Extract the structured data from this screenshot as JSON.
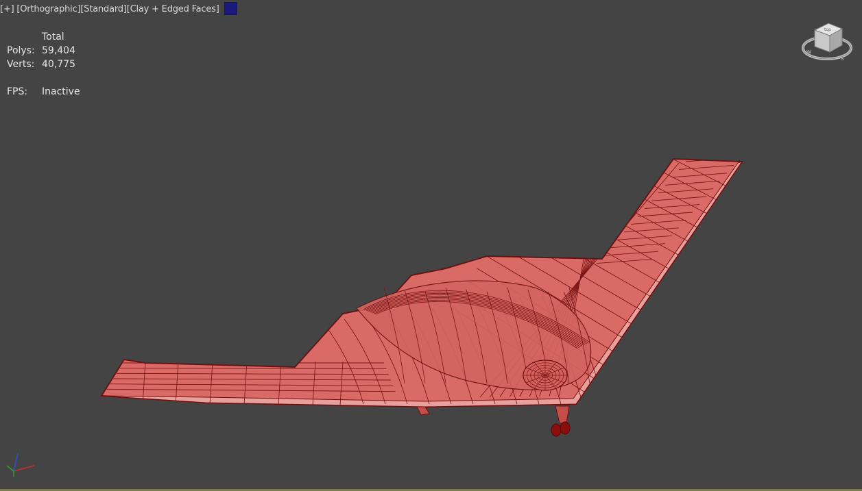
{
  "viewport": {
    "menu": {
      "plus_label": "[+]",
      "view_label": "[Orthographic]",
      "shading_mode_label": "[Standard]",
      "display_style_label": "[Clay + Edged Faces]",
      "swatch_color": "#1a1a7c"
    },
    "stats": {
      "header": "Total",
      "polys_label": "Polys:",
      "polys_value": "59,404",
      "verts_label": "Verts:",
      "verts_value": "40,775",
      "fps_label": "FPS:",
      "fps_value": "Inactive"
    },
    "model": {
      "name_icon": "mesh-model",
      "fill_color": "#d96a66",
      "edge_color": "#7a1616"
    },
    "viewcube": {
      "icon": "viewcube-icon",
      "face_label": "top"
    },
    "axis_tripod": {
      "icon": "axis-tripod-icon"
    },
    "colors": {
      "background": "#444444",
      "text": "#e6e6e6"
    }
  }
}
